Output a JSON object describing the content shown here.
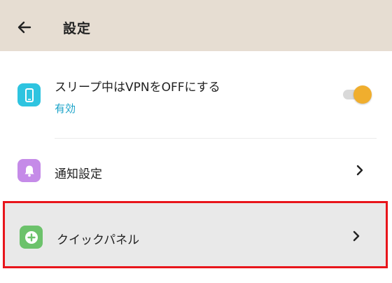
{
  "header": {
    "title": "設定",
    "back_icon": "arrow-left-icon",
    "background": "#e6ddd2"
  },
  "settings": {
    "vpn_sleep": {
      "title": "スリープ中はVPNをOFFにする",
      "status": "有効",
      "icon": "smartphone-icon",
      "icon_color": "#2ec4e0",
      "toggle_on": true,
      "toggle_color": "#f0ae2e"
    },
    "notifications": {
      "title": "通知設定",
      "icon": "bell-icon",
      "icon_color": "#c58be8"
    },
    "quick_panel": {
      "title": "クイックパネル",
      "icon": "plus-circle-icon",
      "icon_color": "#6cc26b",
      "highlighted": true,
      "highlight_color": "#e8151b"
    }
  }
}
